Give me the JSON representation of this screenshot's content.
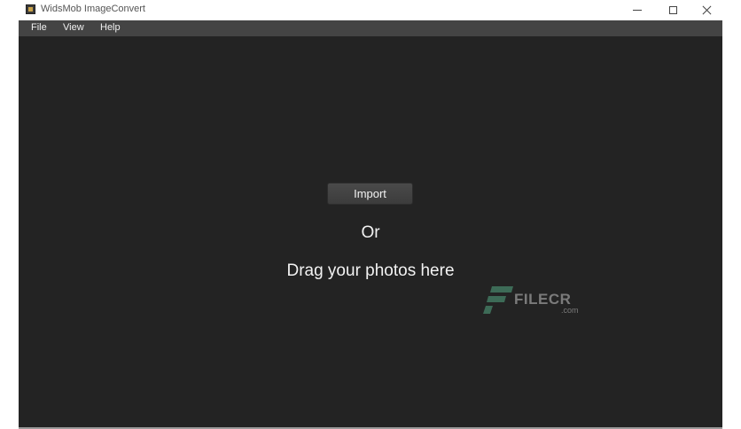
{
  "window": {
    "title": "WidsMob ImageConvert"
  },
  "menubar": {
    "items": [
      "File",
      "View",
      "Help"
    ]
  },
  "main": {
    "import_label": "Import",
    "or_label": "Or",
    "drag_label": "Drag your photos here"
  },
  "watermark": {
    "name": "FILECR",
    "suffix": ".com"
  },
  "colors": {
    "content_bg": "#232323",
    "menubar_bg": "#444444",
    "text": "#f2f2f2",
    "watermark_accent": "#3d6b57"
  }
}
